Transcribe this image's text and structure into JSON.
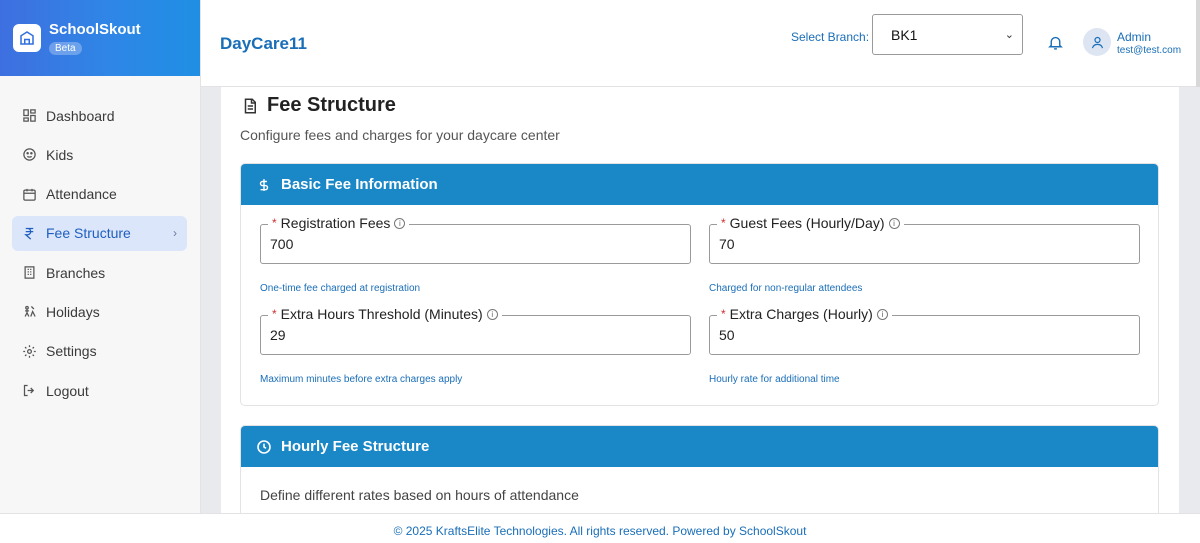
{
  "brand": {
    "name": "SchoolSkout",
    "badge": "Beta"
  },
  "sidebar": {
    "items": [
      {
        "label": "Dashboard",
        "icon": "dashboard-icon"
      },
      {
        "label": "Kids",
        "icon": "kids-icon"
      },
      {
        "label": "Attendance",
        "icon": "calendar-icon"
      },
      {
        "label": "Fee Structure",
        "icon": "rupee-icon",
        "active": true
      },
      {
        "label": "Branches",
        "icon": "building-icon"
      },
      {
        "label": "Holidays",
        "icon": "holiday-icon"
      },
      {
        "label": "Settings",
        "icon": "gear-icon"
      },
      {
        "label": "Logout",
        "icon": "logout-icon"
      }
    ]
  },
  "header": {
    "org_name": "DayCare11",
    "branch_label": "Select Branch:",
    "branch_value": "BK1",
    "user_name": "Admin",
    "user_email": "test@test.com"
  },
  "page": {
    "title": "Fee Structure",
    "subtitle": "Configure fees and charges for your daycare center"
  },
  "basic_fee": {
    "title": "Basic Fee Information",
    "fields": [
      {
        "label": "Registration Fees",
        "value": "700",
        "help": "One-time fee charged at registration"
      },
      {
        "label": "Guest Fees (Hourly/Day)",
        "value": "70",
        "help": "Charged for non-regular attendees"
      },
      {
        "label": "Extra Hours Threshold (Minutes)",
        "value": "29",
        "help": "Maximum minutes before extra charges apply"
      },
      {
        "label": "Extra Charges (Hourly)",
        "value": "50",
        "help": "Hourly rate for additional time"
      }
    ]
  },
  "hourly_fee": {
    "title": "Hourly Fee Structure",
    "subtitle": "Define different rates based on hours of attendance"
  },
  "footer": {
    "text": "© 2025 KraftsElite Technologies. All rights reserved. Powered by SchoolSkout"
  },
  "colors": {
    "primary": "#1a87c6",
    "accent_text": "#1a6eb8",
    "required": "#d03030",
    "active_nav_bg": "#dbe6fb"
  }
}
